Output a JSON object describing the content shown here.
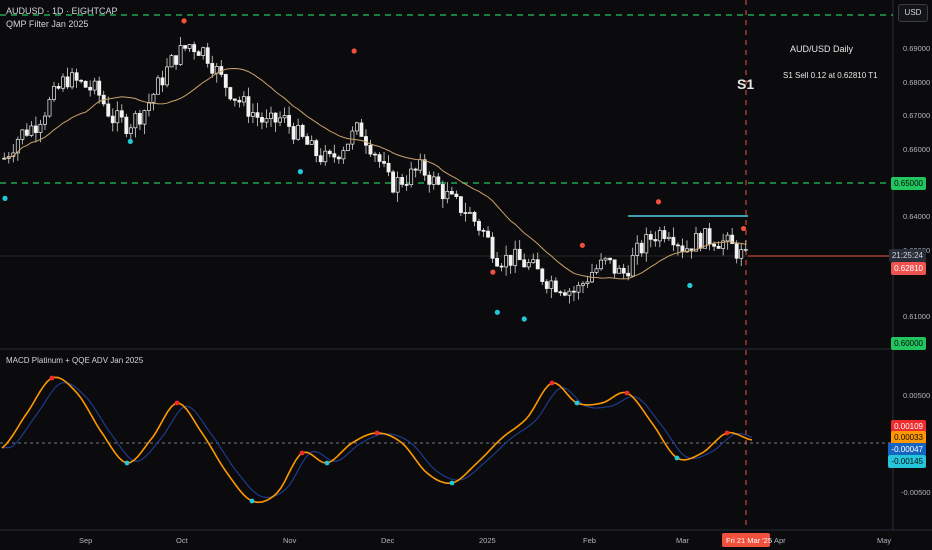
{
  "header": {
    "symbol_line": "AUDUSD · 1D · EIGHTCAP",
    "indicator_main": "QMP Filter Jan 2025",
    "indicator_sub": "MACD Platinum + QQE ADV Jan 2025"
  },
  "currency_button": "USD",
  "annotations": {
    "title": "AUD/USD Daily",
    "signal": "S1 Sell 0.12 at 0.62810 T1",
    "marker": "S1"
  },
  "price_axis": {
    "ticks": [
      "0.69000",
      "0.68000",
      "0.67000",
      "0.66000",
      "0.64000",
      "0.62000",
      "0.61000"
    ],
    "levels": {
      "upper_green": "0.69700",
      "middle_green": "0.65000",
      "lower_green": "0.60000",
      "countdown": "21:25:24",
      "last_price": "0.62810"
    }
  },
  "macd_axis": {
    "ticks": [
      "0.00500",
      "-0.00500"
    ],
    "labels": [
      "0.00109",
      "0.00033",
      "-0.00047",
      "-0.00145"
    ]
  },
  "time_axis": {
    "ticks": [
      "Sep",
      "Oct",
      "Nov",
      "Dec",
      "2025",
      "Feb",
      "Mar",
      "Apr",
      "May"
    ],
    "current": "Fri 21 Mar '25"
  },
  "colors": {
    "green_level": "#22c55e",
    "red_marker": "#f0503c",
    "cyan_marker": "#26c6da",
    "macd_orange": "#ff9800",
    "macd_blue": "#1e3a8a",
    "ma_line": "#c9a26b",
    "last_price": "#ef5350",
    "resistance": "#4dd0e1"
  },
  "chart_data": [
    {
      "type": "candlestick",
      "series": [
        {
          "name": "",
          "values": [
            0.658,
            0.665,
            0.668,
            0.675,
            0.682,
            0.68,
            0.678,
            0.67,
            0.668,
            0.672,
            0.68,
            0.688,
            0.692,
            0.69,
            0.682,
            0.676,
            0.672,
            0.668,
            0.67,
            0.665,
            0.66,
            0.657,
            0.662,
            0.667,
            0.66,
            0.65,
            0.652,
            0.655,
            0.65,
            0.645,
            0.642,
            0.636,
            0.628,
            0.628,
            0.626,
            0.622,
            0.62,
            0.618,
            0.624,
            0.627,
            0.623,
            0.63,
            0.635,
            0.637,
            0.631,
            0.634,
            0.634,
            0.632,
            0.628
          ]
        }
      ],
      "markers": {
        "sell_arrows": [
          0.699,
          0.69,
          0.624,
          0.632,
          0.645,
          0.637
        ],
        "buy_arrows": [
          0.646,
          0.663,
          0.654,
          0.612,
          0.61,
          0.62
        ]
      },
      "levels": [
        0.697,
        0.65,
        0.6
      ],
      "last_price": 0.6281
    },
    {
      "type": "line",
      "series": [
        {
          "name": "",
          "values": [
            -0.0005,
            0.003,
            0.0065,
            0.005,
            0.001,
            -0.002,
            0.0005,
            0.004,
            0.001,
            -0.003,
            -0.0058,
            -0.005,
            -0.001,
            -0.002,
            0.0,
            0.001,
            0.0,
            -0.003,
            -0.004,
            -0.002,
            0.0005,
            0.0025,
            0.006,
            0.004,
            0.004,
            0.005,
            0.002,
            -0.0015,
            -0.001,
            0.001,
            0.0003
          ]
        }
      ]
    }
  ]
}
